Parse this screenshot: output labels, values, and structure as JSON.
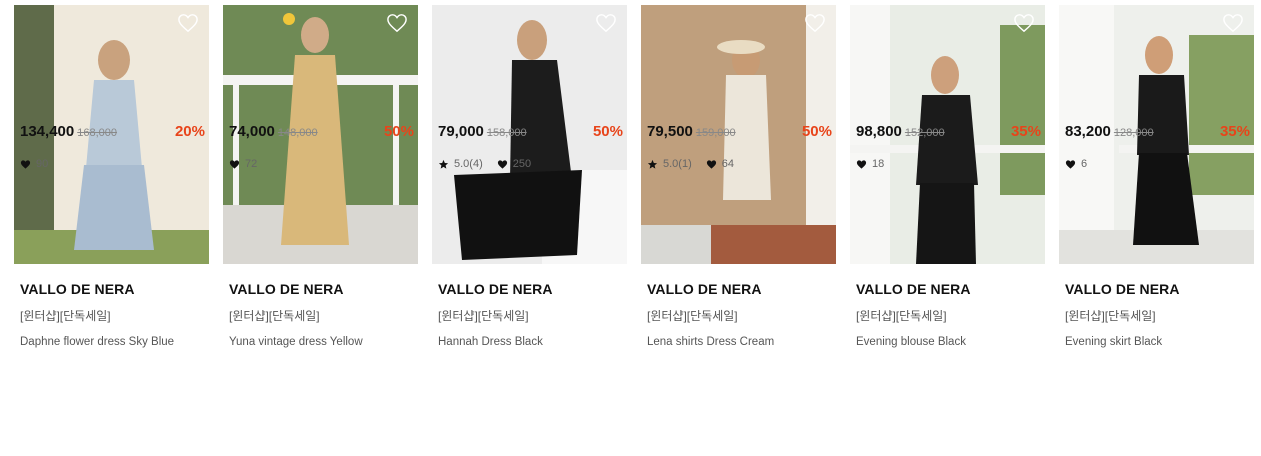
{
  "colors": {
    "accent": "#e8441a",
    "text": "#111111",
    "muted": "#555555"
  },
  "products": [
    {
      "brand": "VALLO DE NERA",
      "tag": "[윈터샵][단독세일]",
      "name": "Daphne flower dress Sky Blue",
      "price": "134,400",
      "original": "168,000",
      "discount": "20%",
      "rating": null,
      "likes": "90",
      "icon": "heart-outline-icon"
    },
    {
      "brand": "VALLO DE NERA",
      "tag": "[윈터샵][단독세일]",
      "name": "Yuna vintage dress Yellow",
      "price": "74,000",
      "original": "148,000",
      "discount": "50%",
      "rating": null,
      "likes": "72",
      "icon": "heart-outline-icon"
    },
    {
      "brand": "VALLO DE NERA",
      "tag": "[윈터샵][단독세일]",
      "name": "Hannah Dress Black",
      "price": "79,000",
      "original": "158,000",
      "discount": "50%",
      "rating": "5.0(4)",
      "likes": "250",
      "icon": "heart-outline-icon"
    },
    {
      "brand": "VALLO DE NERA",
      "tag": "[윈터샵][단독세일]",
      "name": "Lena shirts Dress Cream",
      "price": "79,500",
      "original": "159,000",
      "discount": "50%",
      "rating": "5.0(1)",
      "likes": "64",
      "icon": "heart-outline-icon"
    },
    {
      "brand": "VALLO DE NERA",
      "tag": "[윈터샵][단독세일]",
      "name": "Evening blouse Black",
      "price": "98,800",
      "original": "152,000",
      "discount": "35%",
      "rating": null,
      "likes": "18",
      "icon": "heart-outline-icon"
    },
    {
      "brand": "VALLO DE NERA",
      "tag": "[윈터샵][단독세일]",
      "name": "Evening skirt Black",
      "price": "83,200",
      "original": "128,000",
      "discount": "35%",
      "rating": null,
      "likes": "6",
      "icon": "heart-outline-icon"
    }
  ]
}
